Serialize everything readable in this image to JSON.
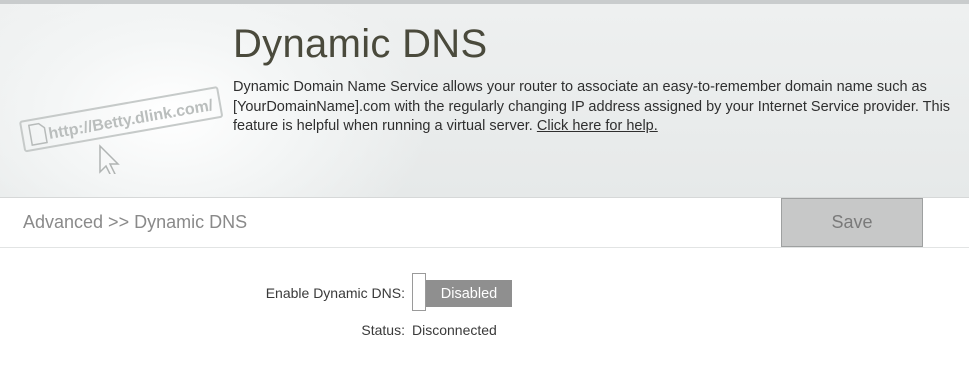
{
  "header": {
    "title": "Dynamic DNS",
    "description": "Dynamic Domain Name Service allows your router to associate an easy-to-remember domain name such as [YourDomainName].com with the regularly changing IP address assigned by your Internet Service provider. This feature is helpful when running a virtual server.",
    "help_link": "Click here for help.",
    "illustration_text": "http://Betty.dlink.com/"
  },
  "breadcrumb": "Advanced >> Dynamic DNS",
  "toolbar": {
    "save_label": "Save"
  },
  "form": {
    "enable_label": "Enable Dynamic DNS:",
    "enable_state": "Disabled",
    "status_label": "Status:",
    "status_value": "Disconnected"
  },
  "colors": {
    "title": "#4a4a3c",
    "toggle_off": "#8f8f8f",
    "save_disabled": "#c7c8c8"
  }
}
